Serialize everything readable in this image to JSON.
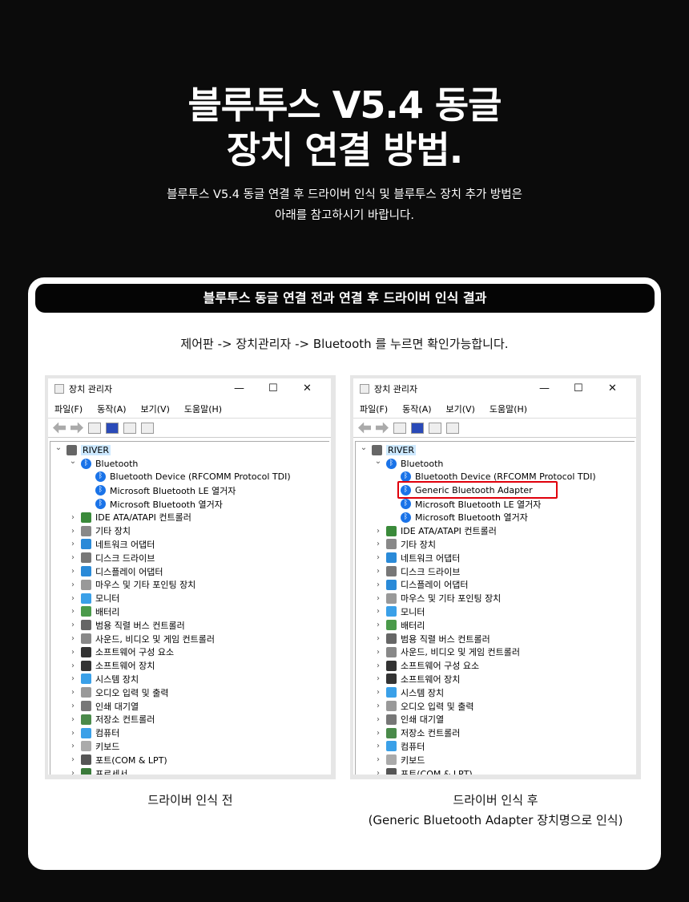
{
  "hero": {
    "title_line1": "블루투스 V5.4 동글",
    "title_line2": "장치 연결 방법.",
    "subtitle_line1": "블루투스 V5.4 동글 연결 후 드라이버 인식 및 블루투스 장치 추가 방법은",
    "subtitle_line2": "아래를 참고하시기 바랍니다."
  },
  "section": {
    "heading": "블루투스 동글 연결 전과 연결 후 드라이버 인식 결과",
    "guide": "제어판 -> 장치관리자 -> Bluetooth 를 누르면 확인가능합니다."
  },
  "window": {
    "title": "장치 관리자",
    "controls": [
      "—",
      "☐",
      "✕"
    ],
    "menu": [
      "파일(F)",
      "동작(A)",
      "보기(V)",
      "도움말(H)"
    ]
  },
  "before": {
    "caption": "드라이버 인식 전",
    "tree": [
      {
        "label": "RIVER",
        "level": 0,
        "exp": "open",
        "icon": "computer"
      },
      {
        "label": "Bluetooth",
        "level": 1,
        "exp": "open",
        "icon": "bt"
      },
      {
        "label": "Bluetooth Device (RFCOMM Protocol TDI)",
        "level": 2,
        "icon": "bt"
      },
      {
        "label": "Microsoft Bluetooth LE 열거자",
        "level": 2,
        "icon": "bt"
      },
      {
        "label": "Microsoft Bluetooth 열거자",
        "level": 2,
        "icon": "bt"
      },
      {
        "label": "IDE ATA/ATAPI 컨트롤러",
        "level": 1,
        "exp": "closed",
        "icon": "#3a8a3a"
      },
      {
        "label": "기타 장치",
        "level": 1,
        "exp": "closed",
        "icon": "#888"
      },
      {
        "label": "네트워크 어댑터",
        "level": 1,
        "exp": "closed",
        "icon": "#2a8ad8"
      },
      {
        "label": "디스크 드라이브",
        "level": 1,
        "exp": "closed",
        "icon": "#777"
      },
      {
        "label": "디스플레이 어댑터",
        "level": 1,
        "exp": "closed",
        "icon": "#2a8ad8"
      },
      {
        "label": "마우스 및 기타 포인팅 장치",
        "level": 1,
        "exp": "closed",
        "icon": "#999"
      },
      {
        "label": "모니터",
        "level": 1,
        "exp": "closed",
        "icon": "#3aa0e8"
      },
      {
        "label": "배터리",
        "level": 1,
        "exp": "closed",
        "icon": "#4a9a4a"
      },
      {
        "label": "범용 직렬 버스 컨트롤러",
        "level": 1,
        "exp": "closed",
        "icon": "#666"
      },
      {
        "label": "사운드, 비디오 및 게임 컨트롤러",
        "level": 1,
        "exp": "closed",
        "icon": "#888"
      },
      {
        "label": "소프트웨어 구성 요소",
        "level": 1,
        "exp": "closed",
        "icon": "#333"
      },
      {
        "label": "소프트웨어 장치",
        "level": 1,
        "exp": "closed",
        "icon": "#333"
      },
      {
        "label": "시스템 장치",
        "level": 1,
        "exp": "closed",
        "icon": "#3aa0e8"
      },
      {
        "label": "오디오 입력 및 출력",
        "level": 1,
        "exp": "closed",
        "icon": "#999"
      },
      {
        "label": "인쇄 대기열",
        "level": 1,
        "exp": "closed",
        "icon": "#777"
      },
      {
        "label": "저장소 컨트롤러",
        "level": 1,
        "exp": "closed",
        "icon": "#4a8a4a"
      },
      {
        "label": "컴퓨터",
        "level": 1,
        "exp": "closed",
        "icon": "#3aa0e8"
      },
      {
        "label": "키보드",
        "level": 1,
        "exp": "closed",
        "icon": "#aaa"
      },
      {
        "label": "포트(COM & LPT)",
        "level": 1,
        "exp": "closed",
        "icon": "#555"
      },
      {
        "label": "프로세서",
        "level": 1,
        "exp": "closed",
        "icon": "#3a7a3a"
      }
    ]
  },
  "after": {
    "caption_line1": "드라이버 인식 후",
    "caption_line2": "(Generic Bluetooth Adapter 장치명으로 인식)",
    "highlighted": "Generic Bluetooth Adapter",
    "highlight_color": "#e0000b",
    "tree": [
      {
        "label": "RIVER",
        "level": 0,
        "exp": "open",
        "icon": "computer"
      },
      {
        "label": "Bluetooth",
        "level": 1,
        "exp": "open",
        "icon": "bt"
      },
      {
        "label": "Bluetooth Device (RFCOMM Protocol TDI)",
        "level": 2,
        "icon": "bt"
      },
      {
        "label": "Generic Bluetooth Adapter",
        "level": 2,
        "icon": "bt",
        "highlight": true
      },
      {
        "label": "Microsoft Bluetooth LE 열거자",
        "level": 2,
        "icon": "bt"
      },
      {
        "label": "Microsoft Bluetooth 열거자",
        "level": 2,
        "icon": "bt"
      },
      {
        "label": "IDE ATA/ATAPI 컨트롤러",
        "level": 1,
        "exp": "closed",
        "icon": "#3a8a3a"
      },
      {
        "label": "기타 장치",
        "level": 1,
        "exp": "closed",
        "icon": "#888"
      },
      {
        "label": "네트워크 어댑터",
        "level": 1,
        "exp": "closed",
        "icon": "#2a8ad8"
      },
      {
        "label": "디스크 드라이브",
        "level": 1,
        "exp": "closed",
        "icon": "#777"
      },
      {
        "label": "디스플레이 어댑터",
        "level": 1,
        "exp": "closed",
        "icon": "#2a8ad8"
      },
      {
        "label": "마우스 및 기타 포인팅 장치",
        "level": 1,
        "exp": "closed",
        "icon": "#999"
      },
      {
        "label": "모니터",
        "level": 1,
        "exp": "closed",
        "icon": "#3aa0e8"
      },
      {
        "label": "배터리",
        "level": 1,
        "exp": "closed",
        "icon": "#4a9a4a"
      },
      {
        "label": "범용 직렬 버스 컨트롤러",
        "level": 1,
        "exp": "closed",
        "icon": "#666"
      },
      {
        "label": "사운드, 비디오 및 게임 컨트롤러",
        "level": 1,
        "exp": "closed",
        "icon": "#888"
      },
      {
        "label": "소프트웨어 구성 요소",
        "level": 1,
        "exp": "closed",
        "icon": "#333"
      },
      {
        "label": "소프트웨어 장치",
        "level": 1,
        "exp": "closed",
        "icon": "#333"
      },
      {
        "label": "시스템 장치",
        "level": 1,
        "exp": "closed",
        "icon": "#3aa0e8"
      },
      {
        "label": "오디오 입력 및 출력",
        "level": 1,
        "exp": "closed",
        "icon": "#999"
      },
      {
        "label": "인쇄 대기열",
        "level": 1,
        "exp": "closed",
        "icon": "#777"
      },
      {
        "label": "저장소 컨트롤러",
        "level": 1,
        "exp": "closed",
        "icon": "#4a8a4a"
      },
      {
        "label": "컴퓨터",
        "level": 1,
        "exp": "closed",
        "icon": "#3aa0e8"
      },
      {
        "label": "키보드",
        "level": 1,
        "exp": "closed",
        "icon": "#aaa"
      },
      {
        "label": "포트(COM & LPT)",
        "level": 1,
        "exp": "closed",
        "icon": "#555"
      }
    ]
  }
}
